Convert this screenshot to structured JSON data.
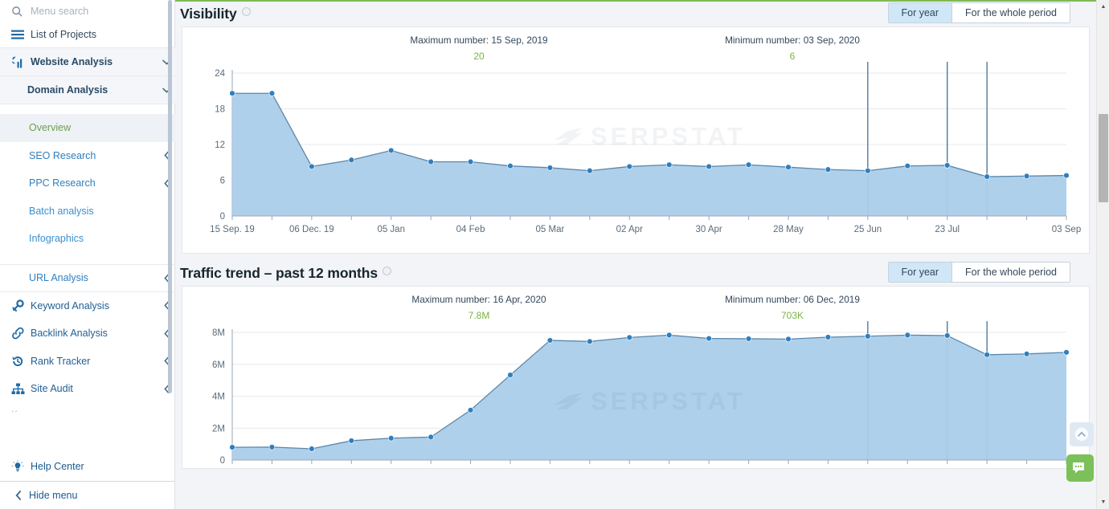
{
  "sidebar": {
    "search": {
      "placeholder": "Menu search",
      "icon": "search-icon"
    },
    "projects": {
      "label": "List of Projects",
      "icon": "hamburger-icon"
    },
    "website_analysis": {
      "label": "Website Analysis",
      "icon": "bar-chart-icon",
      "chevron": "⌄"
    },
    "domain_analysis": {
      "label": "Domain Analysis",
      "chevron": "⌄"
    },
    "sub_items": [
      {
        "label": "Overview",
        "active": true
      },
      {
        "label": "SEO Research",
        "chevron": "‹"
      },
      {
        "label": "PPC Research",
        "chevron": "‹"
      },
      {
        "label": "Batch analysis"
      },
      {
        "label": "Infographics"
      },
      {
        "label": "URL Analysis",
        "chevron": "‹"
      }
    ],
    "main_items": [
      {
        "label": "Keyword Analysis",
        "icon": "key-icon",
        "chevron": "‹"
      },
      {
        "label": "Backlink Analysis",
        "icon": "link-icon",
        "chevron": "‹"
      },
      {
        "label": "Rank Tracker",
        "icon": "history-icon",
        "chevron": "‹"
      },
      {
        "label": "Site Audit",
        "icon": "sitemap-icon",
        "chevron": "‹"
      }
    ],
    "dots": "..",
    "help": {
      "label": "Help Center",
      "icon": "lightbulb-icon"
    },
    "hide": {
      "label": "Hide menu",
      "chevron": "‹"
    }
  },
  "toggle": {
    "for_year": "For year",
    "whole_period": "For the whole period"
  },
  "watermark": "SERPSTAT",
  "sections": [
    {
      "title": "Visibility",
      "max_label": "Maximum number: 15 Sep, 2019",
      "max_value": "20",
      "min_label": "Minimum number: 03 Sep, 2020",
      "min_value": "6"
    },
    {
      "title": "Traffic trend – past 12 months",
      "max_label": "Maximum number: 16 Apr, 2020",
      "max_value": "7.8M",
      "min_label": "Minimum number: 06 Dec, 2019",
      "min_value": "703K"
    }
  ],
  "colors": {
    "accent_green": "#7cb342",
    "series_fill": "#a8cce8",
    "series_line": "#5b87ac",
    "point": "#2f7fbf",
    "toggle_selected": "#cfe7f7",
    "top_rule": "#7ebb52",
    "chat_button": "#7cc05a"
  },
  "chart_data": [
    {
      "type": "area",
      "title": "Visibility",
      "xlabel": "",
      "ylabel": "",
      "ylim": [
        0,
        24
      ],
      "yticks": [
        0,
        6,
        12,
        18,
        24
      ],
      "ytick_labels": [
        "0",
        "6",
        "12",
        "18",
        "24"
      ],
      "grid": true,
      "legend": "none",
      "xtick_labels": [
        "15 Sep. 19",
        "06 Dec. 19",
        "05 Jan",
        "04 Feb",
        "05 Mar",
        "02 Apr",
        "30 Apr",
        "28 May",
        "25 Jun",
        "23 Jul",
        "03 Sep"
      ],
      "xtick_indices": [
        0,
        2,
        4,
        6,
        8,
        10,
        12,
        14,
        16,
        18,
        21
      ],
      "values": [
        20.6,
        20.6,
        8.3,
        9.4,
        11.0,
        9.1,
        9.1,
        8.4,
        8.1,
        7.6,
        8.3,
        8.6,
        8.3,
        8.6,
        8.2,
        7.8,
        7.6,
        8.4,
        8.5,
        6.6,
        6.7,
        6.8
      ],
      "markers": [
        0,
        1,
        2,
        3,
        4,
        5,
        6,
        7,
        8,
        9,
        10,
        11,
        12,
        13,
        14,
        15,
        16,
        17,
        18,
        19,
        20,
        21
      ],
      "vertical_markers": [
        16,
        18,
        19
      ],
      "annotations": {
        "maximum": "20",
        "minimum": "6"
      }
    },
    {
      "type": "area",
      "title": "Traffic trend – past 12 months",
      "xlabel": "",
      "ylabel": "",
      "ylim": [
        0,
        8000000
      ],
      "yticks": [
        0,
        2000000,
        4000000,
        6000000,
        8000000
      ],
      "ytick_labels": [
        "0",
        "2M",
        "4M",
        "6M",
        "8M"
      ],
      "grid": true,
      "legend": "none",
      "values": [
        800000,
        810000,
        703000,
        1210000,
        1370000,
        1440000,
        3130000,
        5330000,
        7500000,
        7430000,
        7680000,
        7830000,
        7620000,
        7600000,
        7580000,
        7700000,
        7760000,
        7830000,
        7800000,
        6600000,
        6650000,
        6750000
      ],
      "markers": [
        0,
        1,
        2,
        3,
        4,
        5,
        6,
        7,
        8,
        9,
        10,
        11,
        12,
        13,
        14,
        15,
        16,
        17,
        18,
        19,
        20,
        21
      ],
      "vertical_markers": [
        16,
        18,
        19
      ],
      "annotations": {
        "maximum": "7.8M",
        "minimum": "703K"
      }
    }
  ]
}
